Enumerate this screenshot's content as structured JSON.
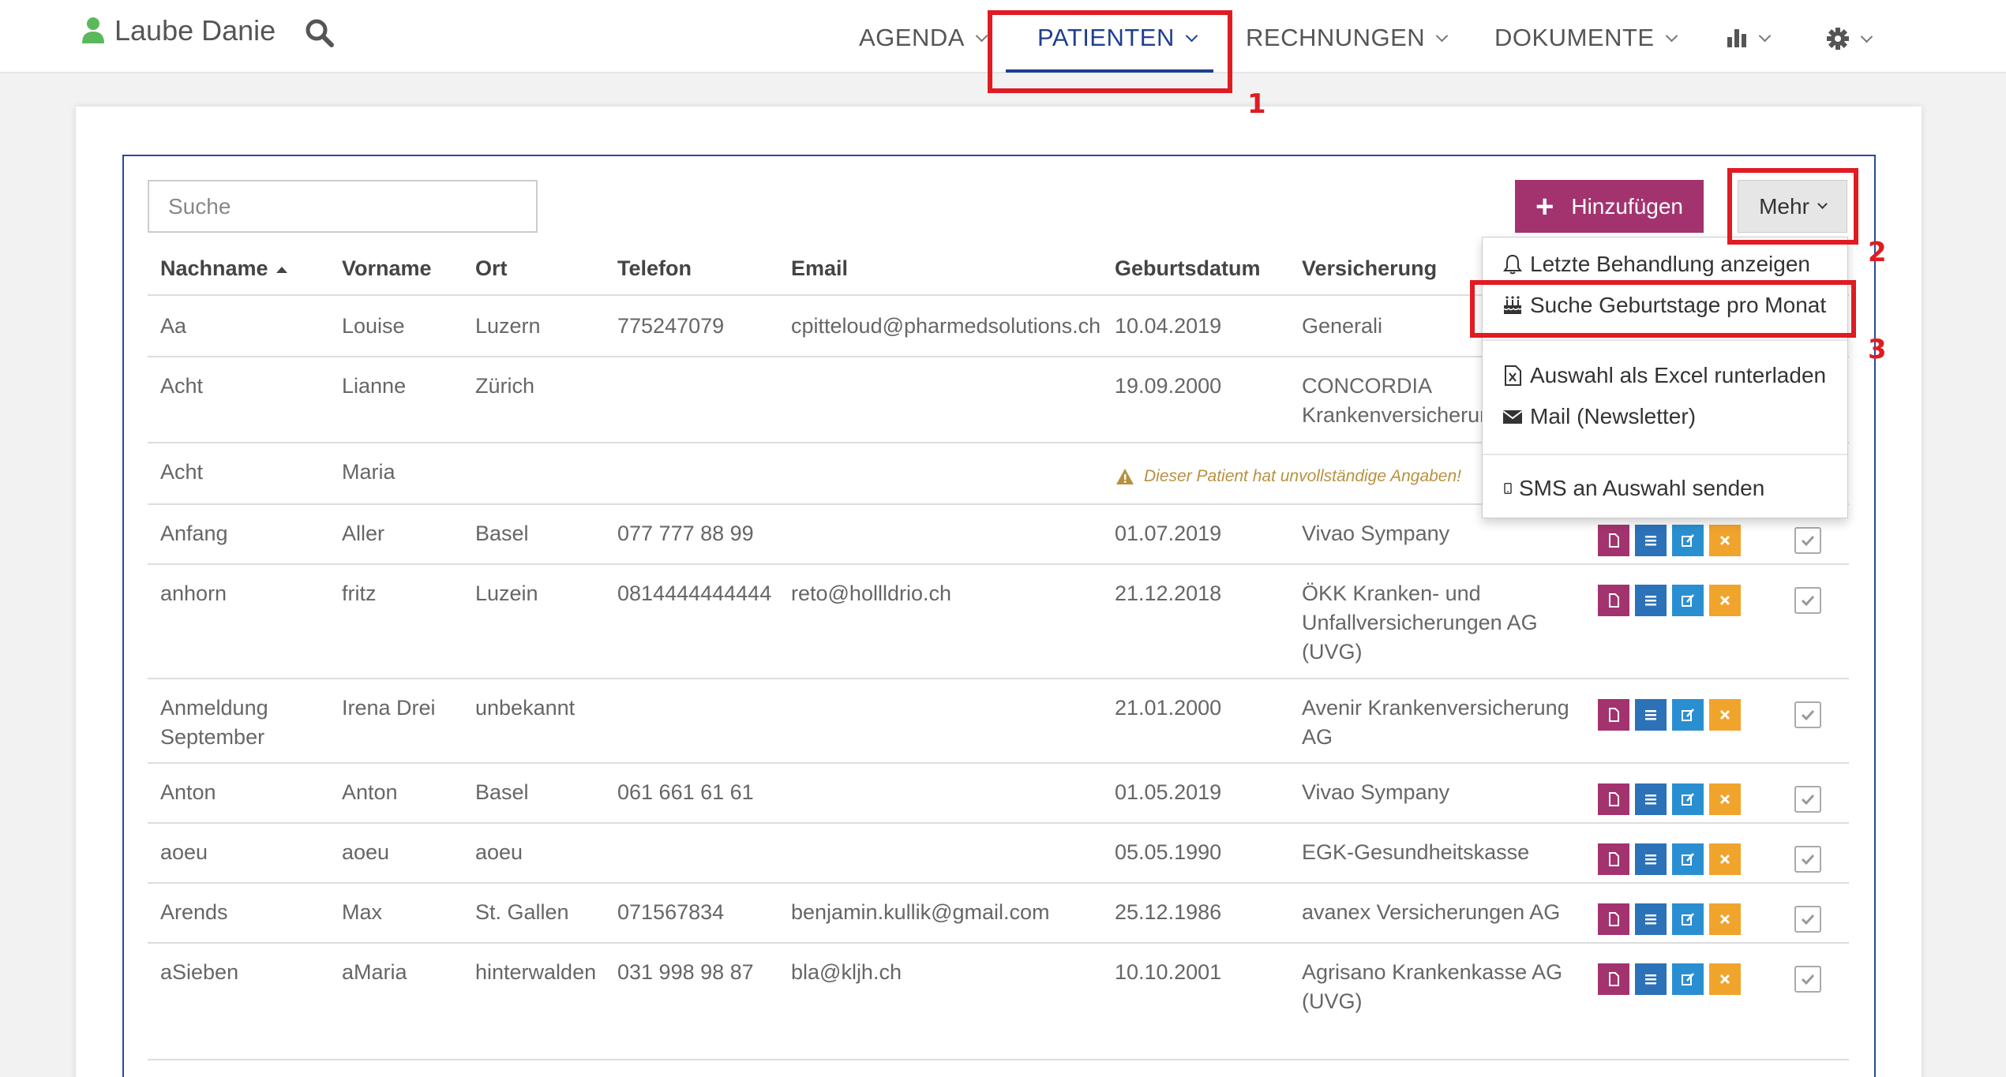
{
  "navbar": {
    "user_name": "Laube Danie",
    "items": [
      {
        "label": "AGENDA"
      },
      {
        "label": "PATIENTEN"
      },
      {
        "label": "RECHNUNGEN"
      },
      {
        "label": "DOKUMENTE"
      }
    ],
    "icons": [
      "user-icon",
      "search-icon",
      "bar-chart-icon",
      "gear-icon"
    ]
  },
  "annotations": {
    "one": "1",
    "two": "2",
    "three": "3"
  },
  "toolbar": {
    "search_placeholder": "Suche",
    "add_label": "Hinzufügen",
    "more_label": "Mehr"
  },
  "table": {
    "headers": [
      "Nachname",
      "Vorname",
      "Ort",
      "Telefon",
      "Email",
      "Geburtsdatum",
      "Versicherung"
    ],
    "rows": [
      {
        "nachname": "Aa",
        "vorname": "Louise",
        "ort": "Luzern",
        "telefon": "775247079",
        "email": "cpitteloud@pharmedsolutions.ch",
        "geburtsdatum": "10.04.2019",
        "versicherung": [
          "Generali"
        ]
      },
      {
        "nachname": "Acht",
        "vorname": "Lianne",
        "ort": "Zürich",
        "telefon": "",
        "email": "",
        "geburtsdatum": "19.09.2000",
        "versicherung": [
          "CONCORDIA",
          "Krankenversicherun"
        ]
      },
      {
        "nachname": "Acht",
        "vorname": "Maria",
        "ort": "",
        "telefon": "",
        "email": "",
        "geburtsdatum": "",
        "versicherung": [],
        "warning": "Dieser Patient hat unvollständige Angaben!"
      },
      {
        "nachname": "Anfang",
        "vorname": "Aller",
        "ort": "Basel",
        "telefon": "077 777 88 99",
        "email": "",
        "geburtsdatum": "01.07.2019",
        "versicherung": [
          "Vivao Sympany"
        ]
      },
      {
        "nachname": "anhorn",
        "vorname": "fritz",
        "ort": "Luzein",
        "telefon": "0814444444444",
        "email": "reto@hollldrio.ch",
        "geburtsdatum": "21.12.2018",
        "versicherung": [
          "ÖKK Kranken- und",
          "Unfallversicherungen AG",
          "(UVG)"
        ]
      },
      {
        "nachname": [
          "Anmeldung",
          "September"
        ],
        "vorname": "Irena Drei",
        "ort": "unbekannt",
        "telefon": "",
        "email": "",
        "geburtsdatum": "21.01.2000",
        "versicherung": [
          "Avenir Krankenversicherung",
          "AG"
        ]
      },
      {
        "nachname": "Anton",
        "vorname": "Anton",
        "ort": "Basel",
        "telefon": "061 661 61 61",
        "email": "",
        "geburtsdatum": "01.05.2019",
        "versicherung": [
          "Vivao Sympany"
        ]
      },
      {
        "nachname": "aoeu",
        "vorname": "aoeu",
        "ort": "aoeu",
        "telefon": "",
        "email": "",
        "geburtsdatum": "05.05.1990",
        "versicherung": [
          "EGK-Gesundheitskasse"
        ]
      },
      {
        "nachname": "Arends",
        "vorname": "Max",
        "ort": "St. Gallen",
        "telefon": "071567834",
        "email": "benjamin.kullik@gmail.com",
        "geburtsdatum": "25.12.1986",
        "versicherung": [
          "avanex Versicherungen AG"
        ]
      },
      {
        "nachname": "aSieben",
        "vorname": "aMaria",
        "ort": "hinterwalden",
        "telefon": "031 998 98 87",
        "email": "bla@kljh.ch",
        "geburtsdatum": "10.10.2001",
        "versicherung": [
          "Agrisano Krankenkasse AG",
          "(UVG)"
        ]
      }
    ]
  },
  "dropdown": {
    "items": [
      {
        "label": "Letzte Behandlung anzeigen",
        "icon": "bell-icon"
      },
      {
        "label": "Suche Geburtstage pro Monat",
        "icon": "birthday-cake-icon"
      },
      {
        "label": "Auswahl als Excel runterladen",
        "icon": "excel-file-icon"
      },
      {
        "label": "Mail (Newsletter)",
        "icon": "envelope-icon"
      },
      {
        "label": "SMS an Auswahl senden",
        "icon": "mobile-phone-icon"
      }
    ]
  },
  "colors": {
    "nav_active": "#1f3f8f",
    "add_button": "#a3336f",
    "annotation": "#e01b22",
    "warning": "#b8913f"
  }
}
